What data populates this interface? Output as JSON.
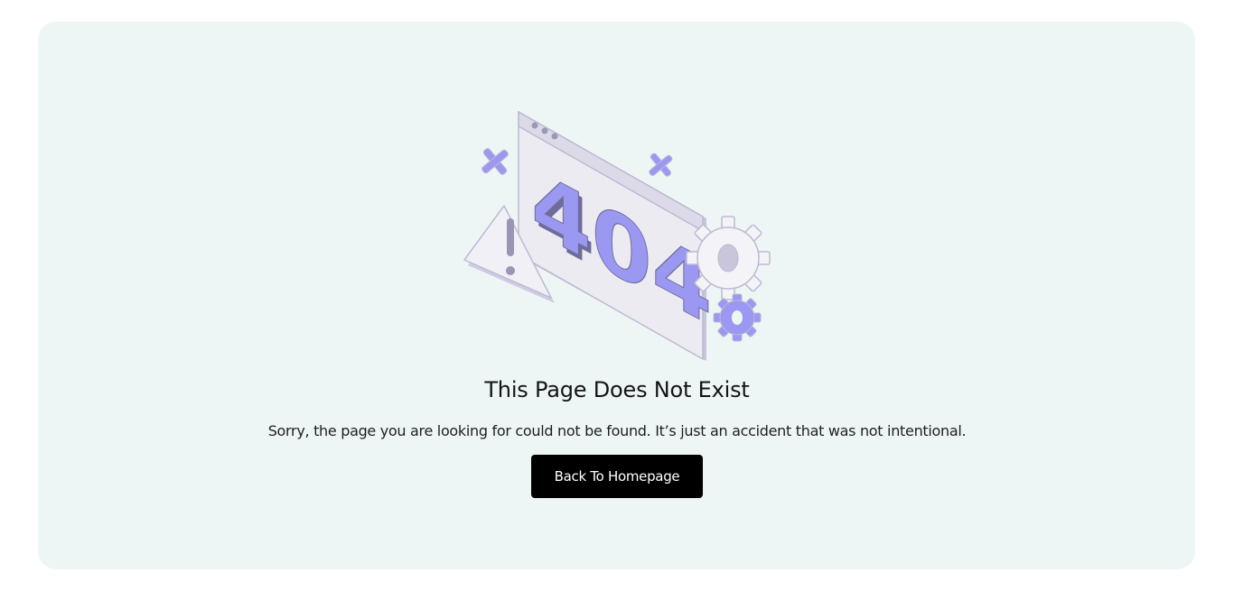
{
  "error_page": {
    "illustration_text": "404",
    "title": "This Page Does Not Exist",
    "message": "Sorry, the page you are looking for could not be found. It’s just an accident that was not intentional.",
    "button_label": "Back To Homepage"
  },
  "colors": {
    "card_background": "#eef6f5",
    "accent_purple": "#9b98f2",
    "button_background": "#000000",
    "button_text": "#ffffff"
  },
  "icons": [
    "browser-window-icon",
    "warning-triangle-icon",
    "gear-icon",
    "plus-sparkle-icon"
  ]
}
